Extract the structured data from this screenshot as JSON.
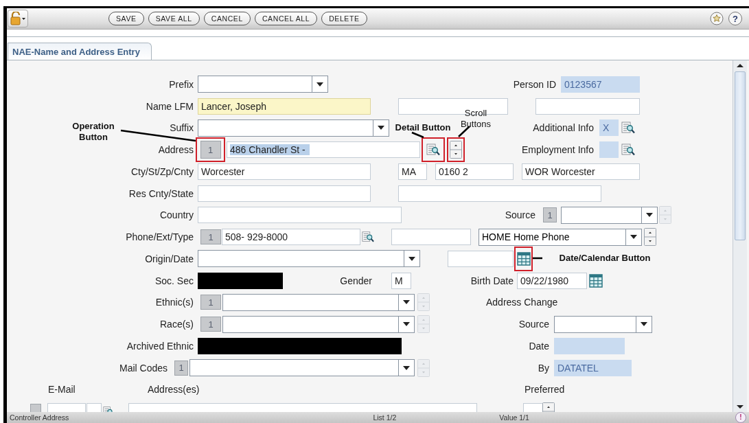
{
  "toolbar": {
    "buttons": [
      "SAVE",
      "SAVE ALL",
      "CANCEL",
      "CANCEL ALL",
      "DELETE"
    ],
    "help": "?"
  },
  "tabs": [
    {
      "label": "NAE-Name and Address Entry",
      "selected": true
    }
  ],
  "form": {
    "rows": [
      {
        "items": [
          {
            "kind": "label",
            "text": "Prefix"
          },
          {
            "kind": "dropdown"
          },
          {
            "kind": "label",
            "text": "Person ID"
          },
          {
            "kind": "field",
            "readonly": true,
            "required": false,
            "value": "0123567"
          }
        ]
      },
      {
        "items": [
          {
            "kind": "label",
            "text": "Name LFM"
          },
          {
            "kind": "field",
            "readonly": false,
            "required": true,
            "value": "Lancer, Joseph"
          },
          {
            "kind": "field",
            "readonly": false,
            "required": false
          },
          {
            "kind": "field",
            "readonly": false,
            "required": false
          }
        ]
      },
      {
        "items": [
          {
            "kind": "label",
            "text": "Suffix"
          },
          {
            "kind": "dropdown"
          },
          {
            "kind": "label",
            "text": "Additional Info"
          },
          {
            "kind": "field",
            "readonly": true,
            "required": false,
            "value": "X"
          },
          {
            "kind": "detail"
          }
        ]
      },
      {
        "items": [
          {
            "kind": "label",
            "text": "Address"
          },
          {
            "kind": "counter",
            "text": "1",
            "outlined": true
          },
          {
            "kind": "field",
            "readonly": false,
            "required": false,
            "value": "486 Chandler St -",
            "text_selected": true
          },
          {
            "kind": "detail",
            "outlined": true
          },
          {
            "kind": "spinner",
            "disabled": false,
            "outlined": true
          },
          {
            "kind": "label",
            "text": "Employment Info"
          },
          {
            "kind": "field",
            "readonly": true,
            "required": false
          },
          {
            "kind": "detail"
          }
        ]
      },
      {
        "items": [
          {
            "kind": "label",
            "text": "Cty/St/Zp/Cnty"
          },
          {
            "kind": "field",
            "readonly": false,
            "required": false,
            "value": "Worcester"
          },
          {
            "kind": "field",
            "readonly": false,
            "required": false,
            "value": "MA"
          },
          {
            "kind": "field",
            "readonly": false,
            "required": false,
            "value": "0160 2"
          },
          {
            "kind": "field",
            "readonly": false,
            "required": false,
            "value": "WOR Worcester"
          }
        ]
      },
      {
        "items": [
          {
            "kind": "label",
            "text": "Res Cnty/State"
          },
          {
            "kind": "field",
            "readonly": false,
            "required": false
          },
          {
            "kind": "field",
            "readonly": false,
            "required": false
          }
        ]
      },
      {
        "items": [
          {
            "kind": "label",
            "text": "Country"
          },
          {
            "kind": "field",
            "readonly": false,
            "required": false
          },
          {
            "kind": "label",
            "text": "Source"
          },
          {
            "kind": "counter",
            "text": "1"
          },
          {
            "kind": "dropdown"
          },
          {
            "kind": "spinner",
            "disabled": true
          }
        ]
      },
      {
        "items": [
          {
            "kind": "label",
            "text": "Phone/Ext/Type"
          },
          {
            "kind": "counter",
            "text": "1"
          },
          {
            "kind": "field",
            "readonly": false,
            "required": false,
            "value": "508- 929-8000"
          },
          {
            "kind": "detail"
          },
          {
            "kind": "field",
            "readonly": false,
            "required": false
          },
          {
            "kind": "dropdown",
            "value": "HOME Home Phone"
          },
          {
            "kind": "spinner",
            "disabled": false
          }
        ]
      },
      {
        "items": [
          {
            "kind": "label",
            "text": "Origin/Date"
          },
          {
            "kind": "dropdown"
          },
          {
            "kind": "field",
            "readonly": false,
            "required": false
          },
          {
            "kind": "calendar",
            "outlined": true
          }
        ]
      },
      {
        "items": [
          {
            "kind": "label",
            "text": "Soc. Sec"
          },
          {
            "kind": "redacted"
          },
          {
            "kind": "label",
            "text": "Gender"
          },
          {
            "kind": "field",
            "readonly": false,
            "required": false,
            "value": "M"
          },
          {
            "kind": "label",
            "text": "Birth Date"
          },
          {
            "kind": "field",
            "readonly": false,
            "required": false,
            "value": "09/22/1980"
          },
          {
            "kind": "calendar"
          }
        ]
      },
      {
        "items": [
          {
            "kind": "label",
            "text": "Ethnic(s)"
          },
          {
            "kind": "counter",
            "text": "1"
          },
          {
            "kind": "dropdown"
          },
          {
            "kind": "spinner",
            "disabled": true
          },
          {
            "kind": "label",
            "text": "Address Change"
          }
        ]
      },
      {
        "items": [
          {
            "kind": "label",
            "text": "Race(s)"
          },
          {
            "kind": "counter",
            "text": "1"
          },
          {
            "kind": "dropdown"
          },
          {
            "kind": "spinner",
            "disabled": true
          },
          {
            "kind": "label",
            "text": "Source"
          },
          {
            "kind": "dropdown"
          }
        ]
      },
      {
        "items": [
          {
            "kind": "label",
            "text": "Archived Ethnic"
          },
          {
            "kind": "redacted"
          },
          {
            "kind": "label",
            "text": "Date"
          },
          {
            "kind": "field",
            "readonly": true,
            "required": false
          }
        ]
      },
      {
        "items": [
          {
            "kind": "label",
            "text": "Mail Codes"
          },
          {
            "kind": "counter",
            "text": "1"
          },
          {
            "kind": "dropdown"
          },
          {
            "kind": "spinner",
            "disabled": true
          },
          {
            "kind": "label",
            "text": "By"
          },
          {
            "kind": "field",
            "readonly": true,
            "required": false,
            "value": "DATATEL"
          }
        ]
      },
      {
        "items": [
          {
            "kind": "label",
            "text": "E-Mail"
          },
          {
            "kind": "label",
            "text": "Address(es)"
          },
          {
            "kind": "label",
            "text": "Preferred"
          }
        ]
      },
      {
        "items": [
          {
            "kind": "counter"
          },
          {
            "kind": "field",
            "readonly": false,
            "required": false
          },
          {
            "kind": "field",
            "readonly": false,
            "required": false
          },
          {
            "kind": "detail"
          },
          {
            "kind": "field",
            "readonly": false,
            "required": false
          },
          {
            "kind": "field",
            "readonly": false,
            "required": false
          },
          {
            "kind": "spinner",
            "disabled": false
          }
        ]
      }
    ]
  },
  "annotations": [
    {
      "text": "Operation Button",
      "bold": true
    },
    {
      "text": "Detail Button",
      "bold": true
    },
    {
      "text": "Scroll Buttons",
      "bold": false
    },
    {
      "text": "Date/Calendar Button",
      "bold": true
    }
  ],
  "status_bar": {
    "items": [
      "Controller Address",
      "List 1/2",
      "Value 1/1"
    ],
    "alert": "!"
  }
}
